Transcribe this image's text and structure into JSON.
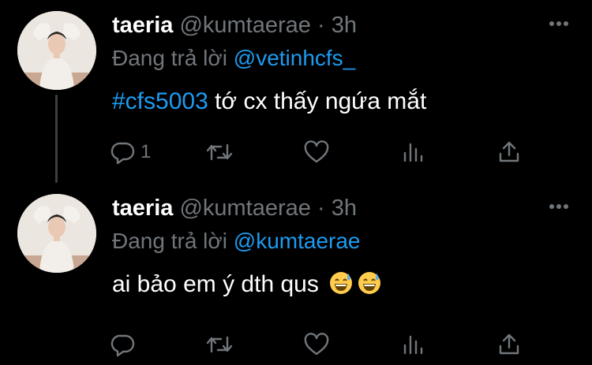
{
  "tweets": [
    {
      "name": "taeria",
      "handle": "@kumtaerae",
      "separator": "·",
      "time": "3h",
      "reply_prefix": "Đang trả lời",
      "reply_to": "@vetinhcfs_",
      "hashtag": "#cfs5003",
      "text": " tớ cx thấy ngứa mắt",
      "reply_count": "1",
      "has_thread_line": true
    },
    {
      "name": "taeria",
      "handle": "@kumtaerae",
      "separator": "·",
      "time": "3h",
      "reply_prefix": "Đang trả lời",
      "reply_to": "@kumtaerae",
      "text": "ai bảo em ý dth qus",
      "emojis": [
        "grinning-face-with-sweat",
        "grinning-face-with-sweat"
      ],
      "reply_count": ""
    }
  ],
  "colors": {
    "background": "#000000",
    "name": "#ffffff",
    "secondary": "#71767b",
    "link": "#1d9bf0",
    "thread_line": "#3b3f44"
  },
  "icons": [
    "reply-icon",
    "retweet-icon",
    "like-icon",
    "stats-icon",
    "share-icon",
    "more-icon"
  ]
}
